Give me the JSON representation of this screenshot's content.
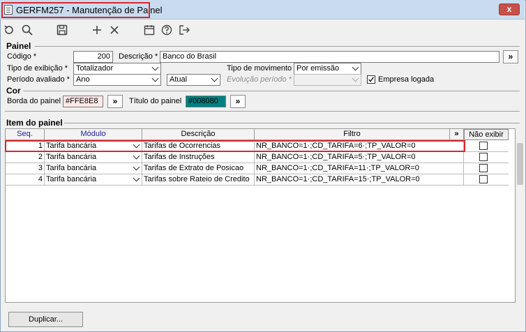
{
  "window": {
    "title": "GERFM257 - Manutenção de Painel",
    "close_label": "x"
  },
  "toolbar": {
    "icons": [
      "undo-icon",
      "search-icon",
      "save-icon",
      "add-icon",
      "delete-icon",
      "calendar-icon",
      "help-icon",
      "exit-icon"
    ]
  },
  "painel": {
    "group_label": "Painel",
    "codigo_label": "Código *",
    "codigo_value": "200",
    "descricao_label": "Descrição *",
    "descricao_value": "Banco do Brasil",
    "descricao_btn": "»",
    "tipo_exibicao_label": "Tipo de exibição *",
    "tipo_exibicao_value": "Totalizador",
    "tipo_movimento_label": "Tipo de movimento",
    "tipo_movimento_value": "Por emissão",
    "periodo_label": "Período avaliado *",
    "periodo_value": "Ano",
    "periodo_atual_value": "Atual",
    "evolucao_label": "Evolução período *",
    "evolucao_value": "",
    "empresa_logada_label": "Empresa logada",
    "empresa_logada_checked": true
  },
  "cor": {
    "group_label": "Cor",
    "borda_label": "Borda do painel",
    "borda_value": "#FFE8E8",
    "borda_btn": "»",
    "titulo_label": "Título do painel",
    "titulo_value": "#008080",
    "titulo_btn": "»",
    "borda_color": "#FFE8E8",
    "titulo_color": "#008080"
  },
  "itens": {
    "group_label": "Item do painel",
    "columns": {
      "seq": "Seq.",
      "modulo": "Módulo",
      "descricao": "Descrição",
      "filtro": "Filtro",
      "expand": "»",
      "nao_exibir": "Não exibir"
    },
    "rows": [
      {
        "seq": "1",
        "modulo": "Tarifa bancária",
        "descricao": "Tarifas de Ocorrencias",
        "filtro": "NR_BANCO=1·;CD_TARIFA=6·;TP_VALOR=0"
      },
      {
        "seq": "2",
        "modulo": "Tarifa bancária",
        "descricao": "Tarifas de Instruções",
        "filtro": "NR_BANCO=1·;CD_TARIFA=5·;TP_VALOR=0"
      },
      {
        "seq": "3",
        "modulo": "Tarifa bancária",
        "descricao": "Tarifas de Extrato de Posicao",
        "filtro": "NR_BANCO=1·;CD_TARIFA=11·;TP_VALOR=0"
      },
      {
        "seq": "4",
        "modulo": "Tarifa bancária",
        "descricao": "Tarifas sobre Rateio de Credito",
        "filtro": "NR_BANCO=1·;CD_TARIFA=15·;TP_VALOR=0"
      }
    ]
  },
  "footer": {
    "duplicar_label": "Duplicar..."
  },
  "colors": {
    "highlight": "#d9262c",
    "titlebar": "#c9dcef"
  }
}
